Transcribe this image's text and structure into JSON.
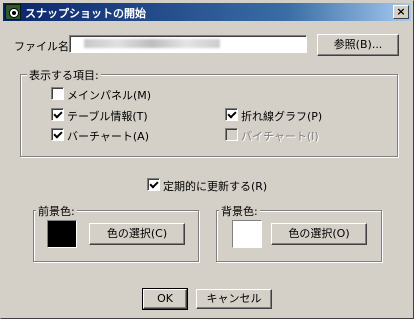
{
  "window": {
    "title": "スナップショットの開始",
    "close_glyph": "×"
  },
  "file": {
    "label": "ファイル名:",
    "value": "",
    "browse_label": "参照(B)..."
  },
  "display_items": {
    "group_title": "表示する項目:",
    "items": [
      {
        "label": "メインパネル(M)",
        "checked": false,
        "enabled": true
      },
      {
        "label": "テーブル情報(T)",
        "checked": true,
        "enabled": true
      },
      {
        "label": "バーチャート(A)",
        "checked": true,
        "enabled": true
      },
      {
        "label": "折れ線グラフ(P)",
        "checked": true,
        "enabled": true
      },
      {
        "label": "パイチャート(I)",
        "checked": false,
        "enabled": false
      }
    ]
  },
  "periodic": {
    "label": "定期的に更新する(R)",
    "checked": true
  },
  "foreground": {
    "group_title": "前景色:",
    "swatch_color": "#000000",
    "button_label": "色の選択(C)"
  },
  "background": {
    "group_title": "背景色:",
    "swatch_color": "#ffffff",
    "button_label": "色の選択(O)"
  },
  "buttons": {
    "ok": "OK",
    "cancel": "キャンセル"
  },
  "colors": {
    "dialog_face": "#d4d0c8",
    "title_start": "#0a246a",
    "title_end": "#a6caf0"
  }
}
